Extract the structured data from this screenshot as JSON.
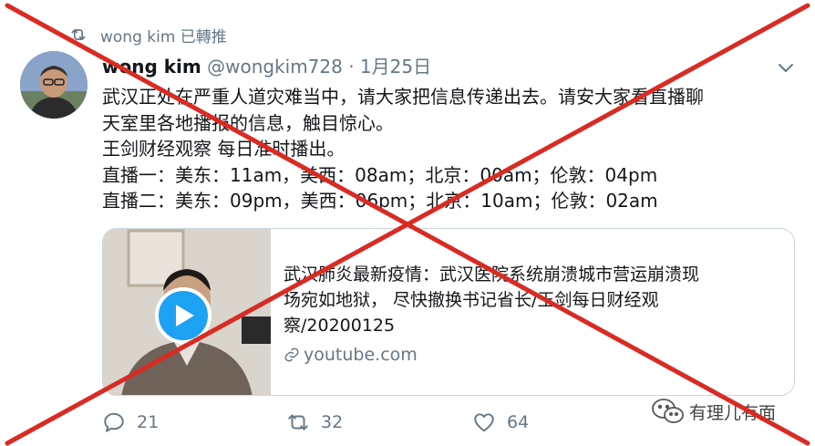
{
  "retweet": {
    "label": "wong kim 已轉推"
  },
  "tweet": {
    "display_name": "wong kim",
    "meta": "@wongkim728 · 1月25日",
    "lines": [
      "武汉正处在严重人道灾难当中，请大家把信息传递出去。请安大家看直播聊",
      "天室里各地播报的信息，触目惊心。",
      "王剑财经观察 每日准时播出。",
      "直播一：美东：11am，美西：08am；北京：00am；伦敦：04pm",
      "直播二：美东：09pm，美西：06pm；北京：10am；伦敦：02am"
    ]
  },
  "card": {
    "title_lines": [
      "武汉肺炎最新疫情：武汉医院系统崩溃城市营运崩溃现",
      "场宛如地狱， 尽快撤换书记省长/王剑每日财经观",
      "察/20200125"
    ],
    "domain": "youtube.com"
  },
  "actions": {
    "replies": "21",
    "retweets": "32",
    "likes": "64"
  },
  "watermark": {
    "text": "有理儿有面"
  },
  "colors": {
    "accent": "#1da1f2",
    "cross": "#d92b24",
    "muted": "#657786"
  }
}
